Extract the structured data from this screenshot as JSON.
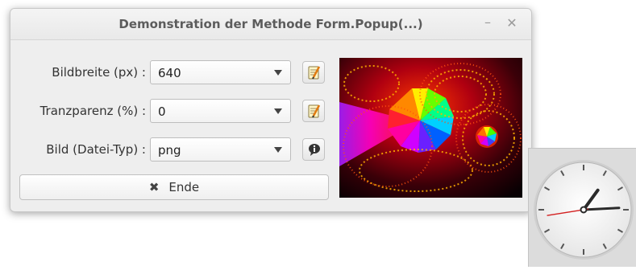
{
  "window": {
    "title": "Demonstration der Methode Form.Popup(...)",
    "minimize_glyph": "–",
    "close_glyph": "✕"
  },
  "form": {
    "rows": [
      {
        "label": "Bildbreite (px) :",
        "value": "640",
        "button_icon": "notepad-edit-icon"
      },
      {
        "label": "Tranzparenz (%) :",
        "value": "0",
        "button_icon": "notepad-edit-icon"
      },
      {
        "label": "Bild (Datei-Typ) :",
        "value": "png",
        "button_icon": "speech-bubble-icon"
      }
    ],
    "end_button": {
      "label": "Ende",
      "icon_glyph": "✖"
    }
  },
  "preview": {
    "image": "fractal-rainbow"
  },
  "clock": {
    "hour_hand": 1.2,
    "minute_hand": 14.5,
    "second_hand": 43.5
  },
  "colors": {
    "window_bg": "#eeeeee",
    "title_text": "#5c5c5c",
    "clock_bg": "#dcdcdc",
    "second_hand": "#d32020"
  }
}
